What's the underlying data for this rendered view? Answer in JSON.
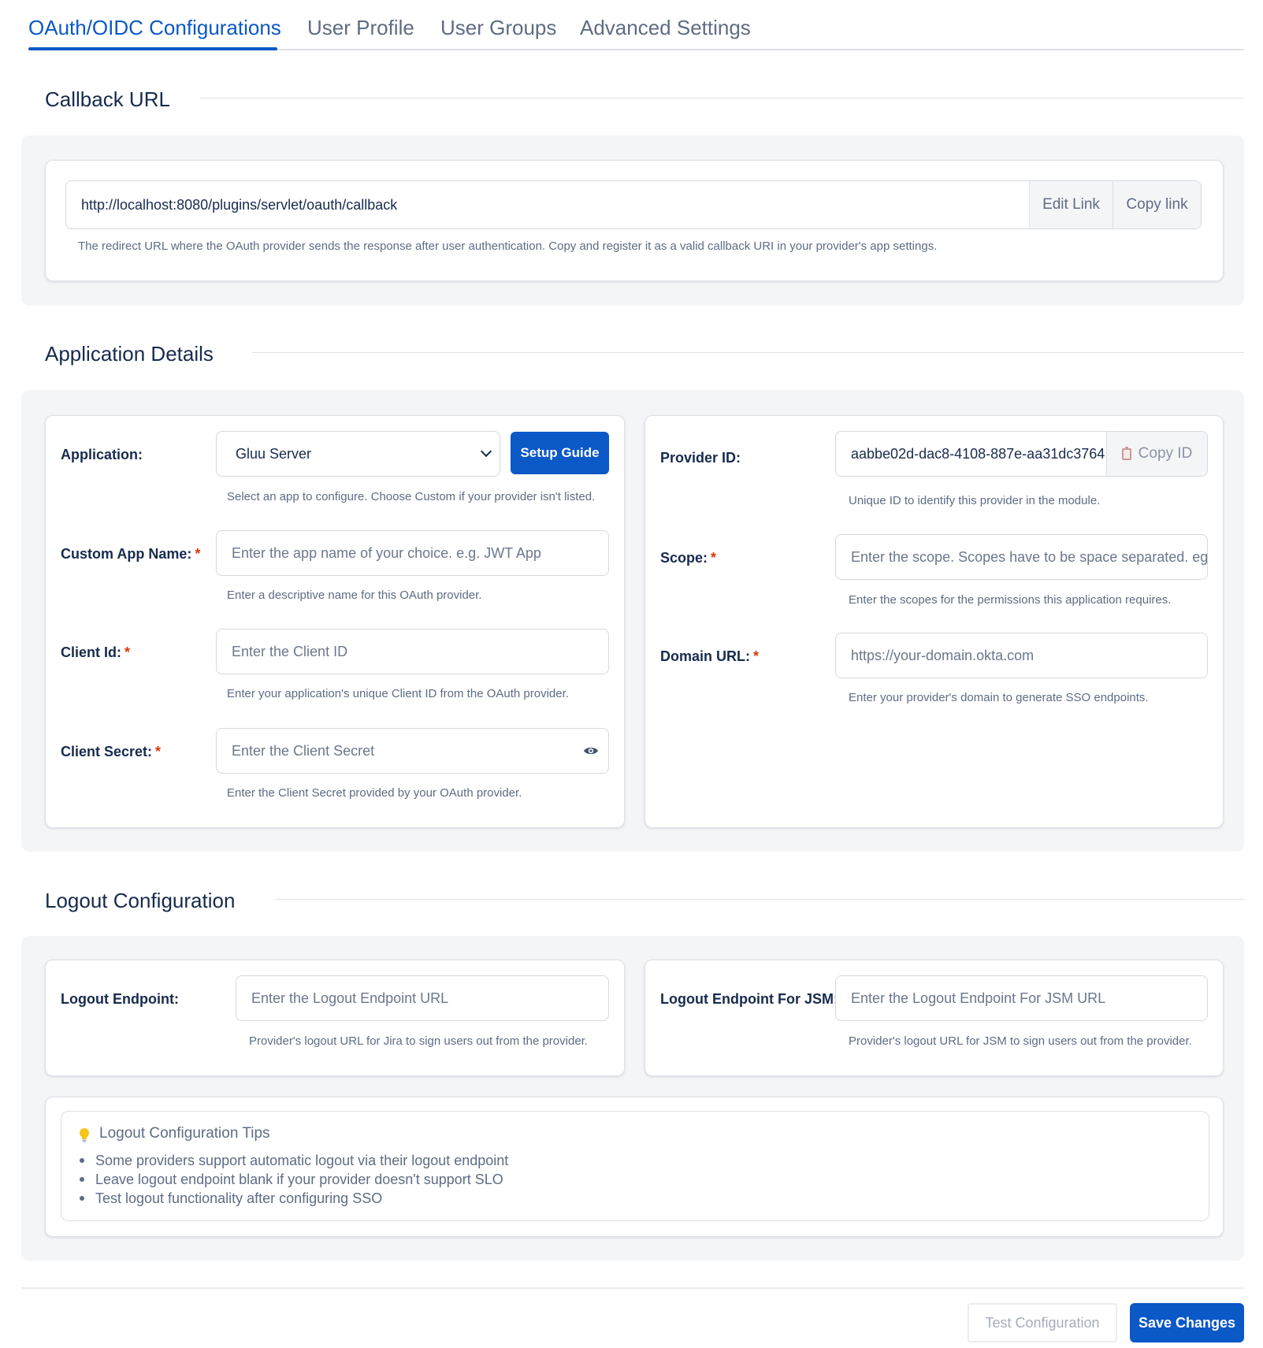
{
  "tabs": [
    {
      "label": "OAuth/OIDC Configurations",
      "active": true
    },
    {
      "label": "User Profile",
      "active": false
    },
    {
      "label": "User Groups",
      "active": false
    },
    {
      "label": "Advanced Settings",
      "active": false
    }
  ],
  "callback": {
    "title": "Callback URL",
    "url": "http://localhost:8080/plugins/servlet/oauth/callback",
    "edit_label": "Edit Link",
    "copy_label": "Copy link",
    "help": "The redirect URL where the OAuth provider sends the response after user authentication. Copy and register it as a valid callback URI in your provider's app settings."
  },
  "app_details": {
    "title": "Application Details",
    "application": {
      "label": "Application:",
      "selected": "Gluu Server",
      "setup_guide": "Setup Guide",
      "help": "Select an app to configure. Choose Custom if your provider isn't listed."
    },
    "custom_app_name": {
      "label": "Custom App Name:",
      "placeholder": "Enter the app name of your choice. e.g. JWT App",
      "help": "Enter a descriptive name for this OAuth provider."
    },
    "client_id": {
      "label": "Client Id:",
      "placeholder": "Enter the Client ID",
      "help": "Enter your application's unique Client ID from the OAuth provider."
    },
    "client_secret": {
      "label": "Client Secret:",
      "placeholder": "Enter the Client Secret",
      "help": "Enter the Client Secret provided by your OAuth provider."
    },
    "provider_id": {
      "label": "Provider ID:",
      "value": "aabbe02d-dac8-4108-887e-aa31dc3764",
      "copy_label": "Copy ID",
      "help": "Unique ID to identify this provider in the module."
    },
    "scope": {
      "label": "Scope:",
      "placeholder": "Enter the scope. Scopes have to be space separated. eg:",
      "help": "Enter the scopes for the permissions this application requires."
    },
    "domain_url": {
      "label": "Domain URL:",
      "placeholder": "https://your-domain.okta.com",
      "help": "Enter your provider's domain to generate SSO endpoints."
    },
    "required_mark": "*"
  },
  "logout": {
    "title": "Logout Configuration",
    "endpoint": {
      "label": "Logout Endpoint:",
      "placeholder": "Enter the Logout Endpoint URL",
      "help": "Provider's logout URL for Jira to sign users out from the provider."
    },
    "endpoint_jsm": {
      "label": "Logout Endpoint For JSM:",
      "placeholder": "Enter the Logout Endpoint For JSM URL",
      "help": "Provider's logout URL for JSM to sign users out from the provider."
    },
    "tips": {
      "title": "Logout Configuration Tips",
      "items": [
        "Some providers support automatic logout via their logout endpoint",
        "Leave logout endpoint blank if your provider doesn't support SLO",
        "Test logout functionality after configuring SSO"
      ]
    }
  },
  "footer": {
    "test_label": "Test Configuration",
    "save_label": "Save Changes"
  },
  "colors": {
    "accent": "#0b58c7",
    "required": "#de350b",
    "panel_bg": "#f4f5f7"
  }
}
